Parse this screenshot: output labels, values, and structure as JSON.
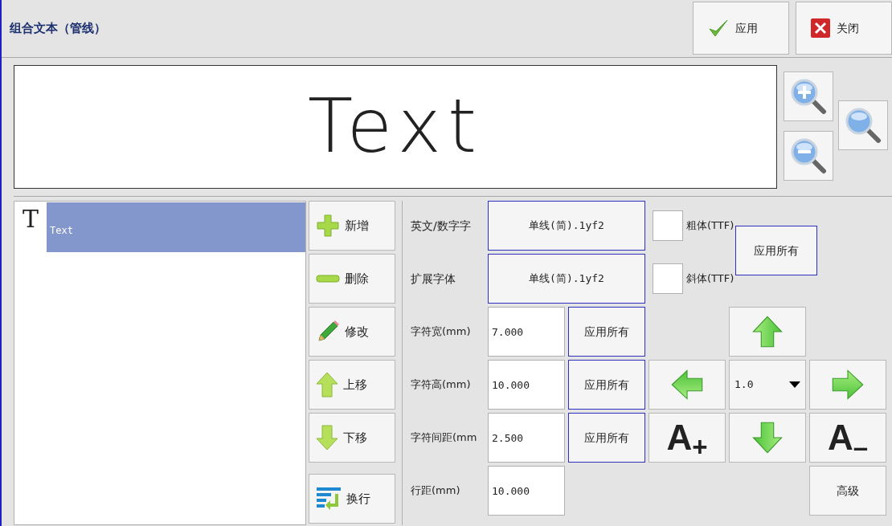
{
  "window": {
    "title": "组合文本（管线）"
  },
  "actions": [
    {
      "label": "应用",
      "kind": "apply"
    },
    {
      "label": "关闭",
      "kind": "close"
    }
  ],
  "preview": {
    "text": "Text"
  },
  "items": [
    {
      "type_mark": "T",
      "label": "Text",
      "selected": true
    }
  ],
  "side_buttons": [
    {
      "label": "新增",
      "kind": "add"
    },
    {
      "label": "删除",
      "kind": "delete"
    },
    {
      "label": "修改",
      "kind": "edit"
    },
    {
      "label": "上移",
      "kind": "up"
    },
    {
      "label": "下移",
      "kind": "down"
    },
    {
      "label": "换行",
      "kind": "wrap"
    }
  ],
  "font_rows": [
    {
      "label": "英文/数字字",
      "value": "单线(简).1yf2"
    },
    {
      "label": "扩展字体",
      "value": "单线(简).1yf2"
    }
  ],
  "style_options": [
    {
      "label": "粗体(TTF)",
      "checked": false
    },
    {
      "label": "斜体(TTF)",
      "checked": false
    }
  ],
  "style_apply": "应用所有",
  "size_rows": [
    {
      "label": "字符宽(mm)",
      "value": "7.000",
      "apply": "应用所有"
    },
    {
      "label": "字符高(mm)",
      "value": "10.000",
      "apply": "应用所有"
    },
    {
      "label": "字符间距(mm",
      "value": "2.500",
      "apply": "应用所有"
    },
    {
      "label": "行距(mm)",
      "value": "10.000"
    }
  ],
  "step": {
    "value": "1.0"
  },
  "grow_label": "A$_{+}$",
  "shrink_label": "A$_{–}$",
  "advanced": "高级"
}
